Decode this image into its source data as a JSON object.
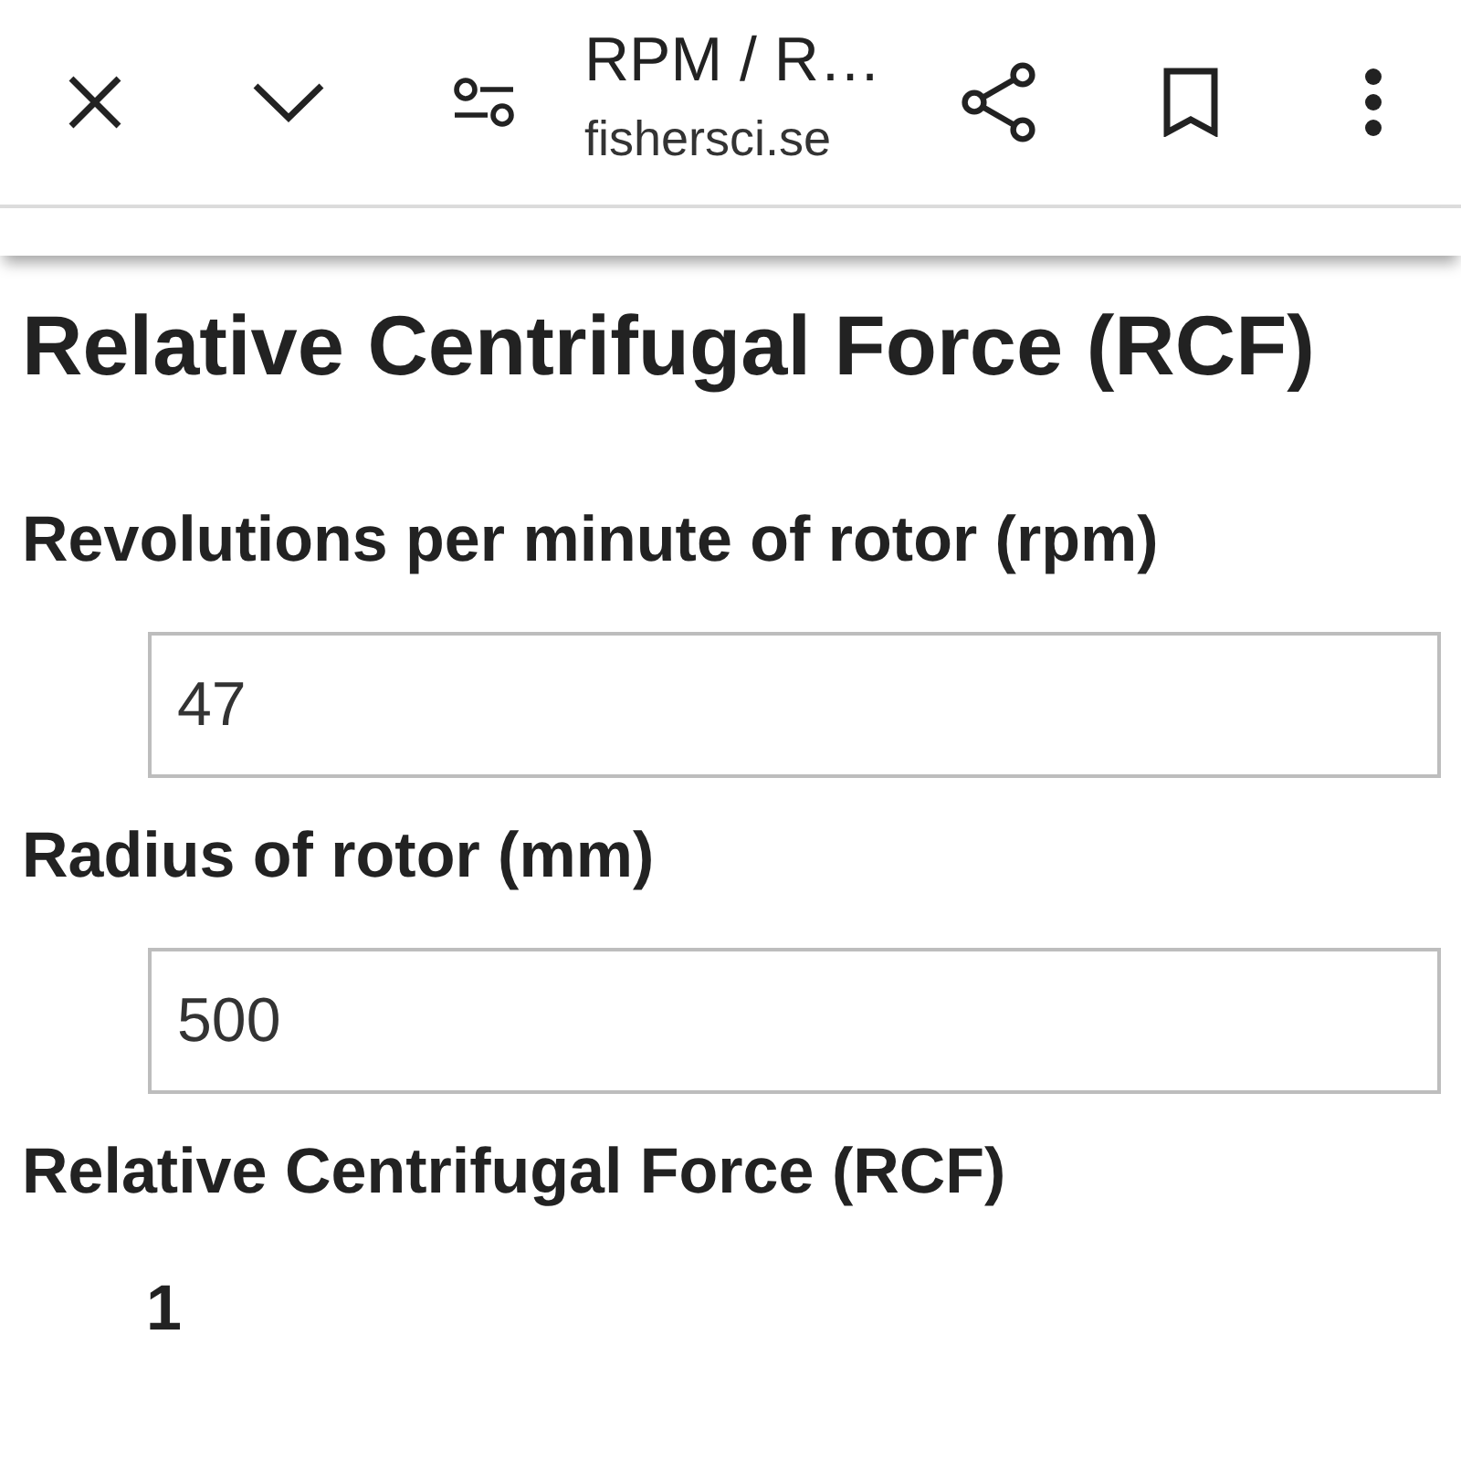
{
  "toolbar": {
    "title": "RPM / R…",
    "url": "fishersci.se"
  },
  "page": {
    "heading": "Relative Centrifugal Force (RCF)",
    "fields": [
      {
        "label": "Revolutions per minute of rotor (rpm)",
        "value": "47"
      },
      {
        "label": "Radius of rotor (mm)",
        "value": "500"
      }
    ],
    "result": {
      "label": "Relative Centrifugal Force (RCF)",
      "value": "1"
    }
  }
}
